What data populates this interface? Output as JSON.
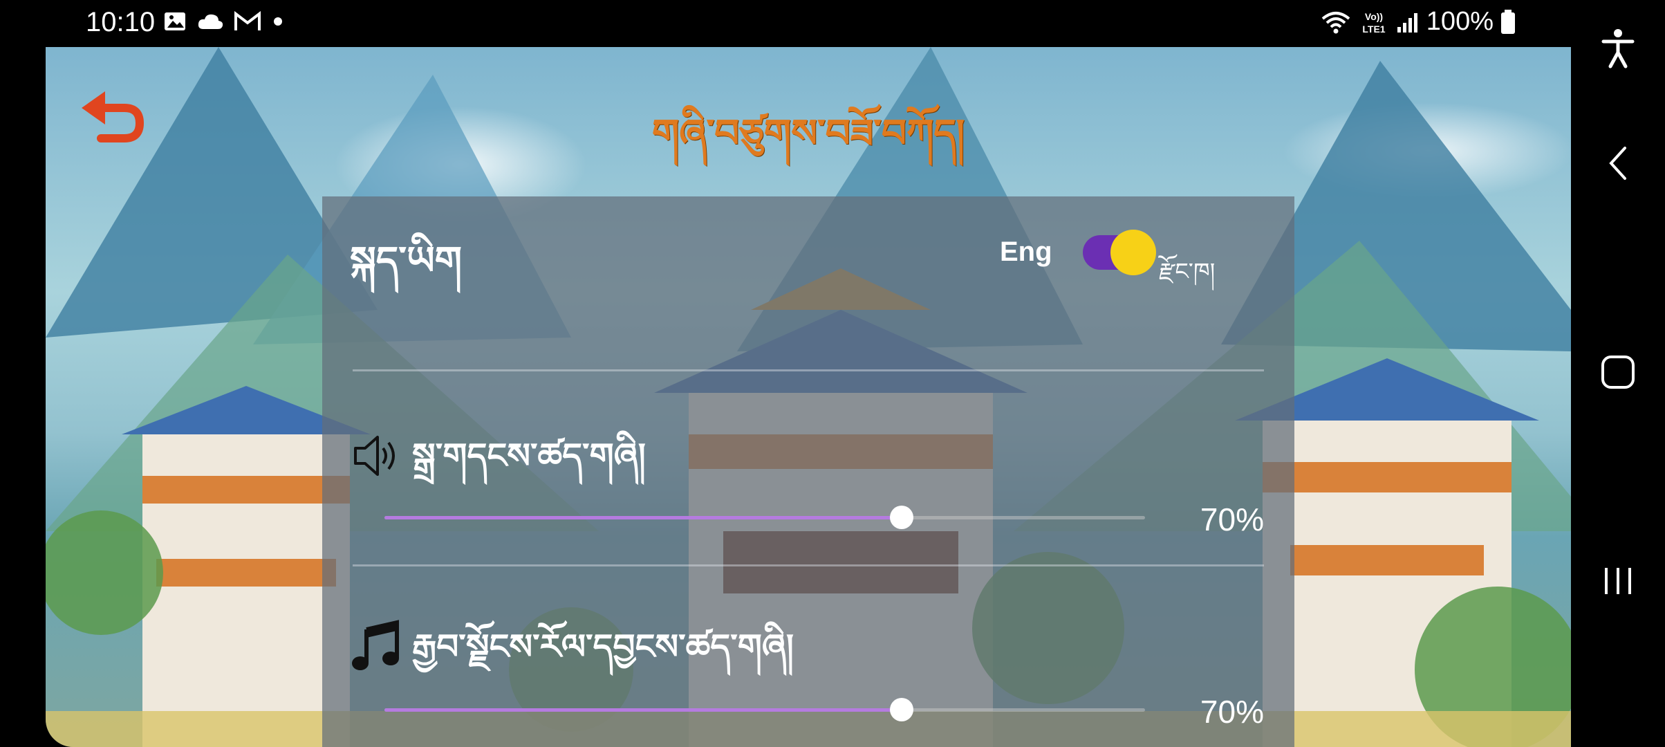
{
  "status_bar": {
    "time": "10:10",
    "battery": "100%",
    "icons": [
      "image-icon",
      "cloud-icon",
      "gmail-icon",
      "dot-icon",
      "wifi-icon",
      "volte-icon",
      "signal-icon",
      "battery-icon"
    ]
  },
  "header": {
    "title": "གཞི་བཙུགས་བཟོ་བཀོད།",
    "back_icon": "back-arrow-icon"
  },
  "language": {
    "label": "སྐད་ཡིག",
    "option_left": "Eng",
    "option_right": "རྫོང་ཁ།",
    "toggle_on": true
  },
  "sound_effects": {
    "label": "སྒྲ་གདངས་ཚད་གཞི།",
    "percent_text": "70%",
    "value": 0.7,
    "icon": "speaker-icon"
  },
  "music": {
    "label": "རྒྱབ་སྗོངས་རོལ་དབྱངས་ཚད་གཞི།",
    "percent_text": "70%",
    "value": 0.7,
    "icon": "music-note-icon"
  },
  "colors": {
    "accent": "#b57be0",
    "toggle_track": "#6b2fb3",
    "toggle_knob": "#f7d117",
    "title": "#e07a1f",
    "back_arrow": "#e0451f"
  }
}
